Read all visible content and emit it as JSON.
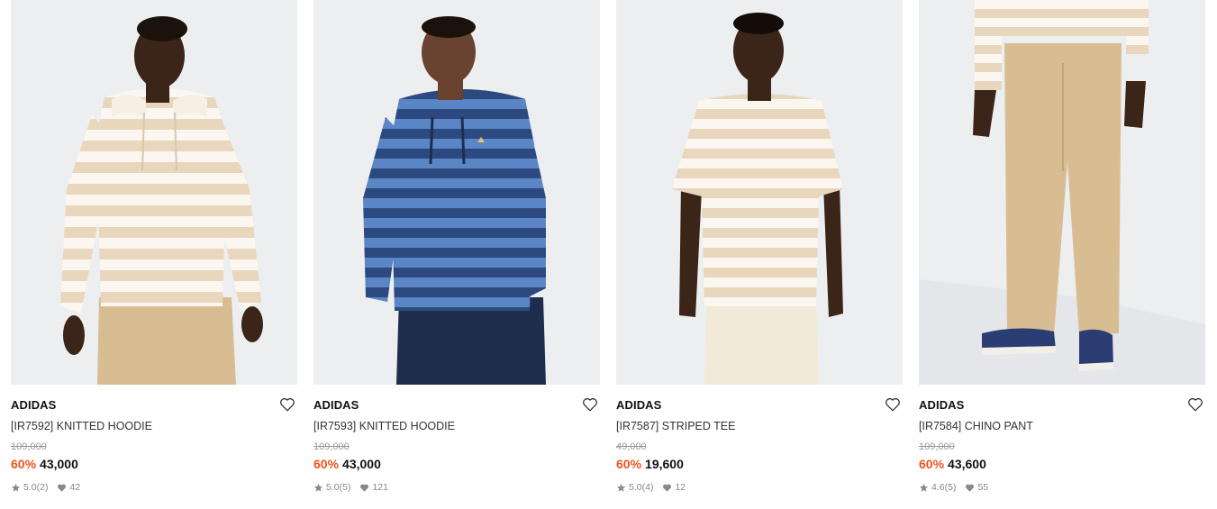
{
  "products": [
    {
      "brand": "ADIDAS",
      "name": "[IR7592] KNITTED HOODIE",
      "original_price": "109,000",
      "discount": "60%",
      "price": "43,000",
      "rating": "5.0",
      "reviews": "(2)",
      "likes": "42",
      "image_icon": "knitted-hoodie-cream-photo"
    },
    {
      "brand": "ADIDAS",
      "name": "[IR7593] KNITTED HOODIE",
      "original_price": "109,000",
      "discount": "60%",
      "price": "43,000",
      "rating": "5.0",
      "reviews": "(5)",
      "likes": "121",
      "image_icon": "knitted-hoodie-blue-photo"
    },
    {
      "brand": "ADIDAS",
      "name": "[IR7587] STRIPED TEE",
      "original_price": "49,000",
      "discount": "60%",
      "price": "19,600",
      "rating": "5.0",
      "reviews": "(4)",
      "likes": "12",
      "image_icon": "striped-tee-photo"
    },
    {
      "brand": "ADIDAS",
      "name": "[IR7584] CHINO PANT",
      "original_price": "109,000",
      "discount": "60%",
      "price": "43,600",
      "rating": "4.6",
      "reviews": "(5)",
      "likes": "55",
      "image_icon": "chino-pant-photo"
    }
  ],
  "colors": {
    "discount": "#f0531c",
    "image_bg": "#eceef0",
    "cream_stripe": "#e8d6bd",
    "blue_light": "#5b86c6",
    "blue_dark": "#2c4a80",
    "khaki": "#d8bd93",
    "navy": "#1f2d4d"
  }
}
